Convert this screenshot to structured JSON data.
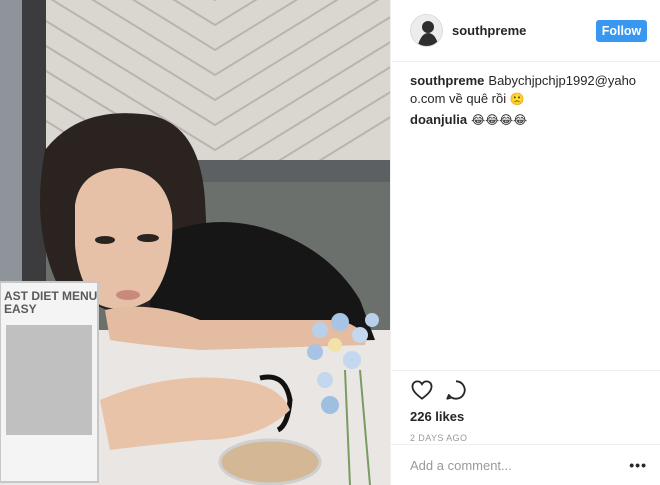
{
  "post": {
    "photo_alt": "",
    "menu_card_text": [
      "AST DIET MENU",
      "EASY"
    ]
  },
  "header": {
    "username": "southpreme",
    "follow_label": "Follow"
  },
  "comments": [
    {
      "user": "southpreme",
      "text": "Babychjpchjp1992@yahoo.com về quê rồi",
      "emoji": "🙁"
    },
    {
      "user": "doanjulia",
      "text": "",
      "emoji": "😂😂😂😂"
    }
  ],
  "actions": {
    "like_icon": "heart-icon",
    "comment_icon": "comment-icon",
    "likes": "226 likes",
    "time": "2 DAYS AGO"
  },
  "add_comment": {
    "placeholder": "Add a comment...",
    "more_label": "•••"
  }
}
